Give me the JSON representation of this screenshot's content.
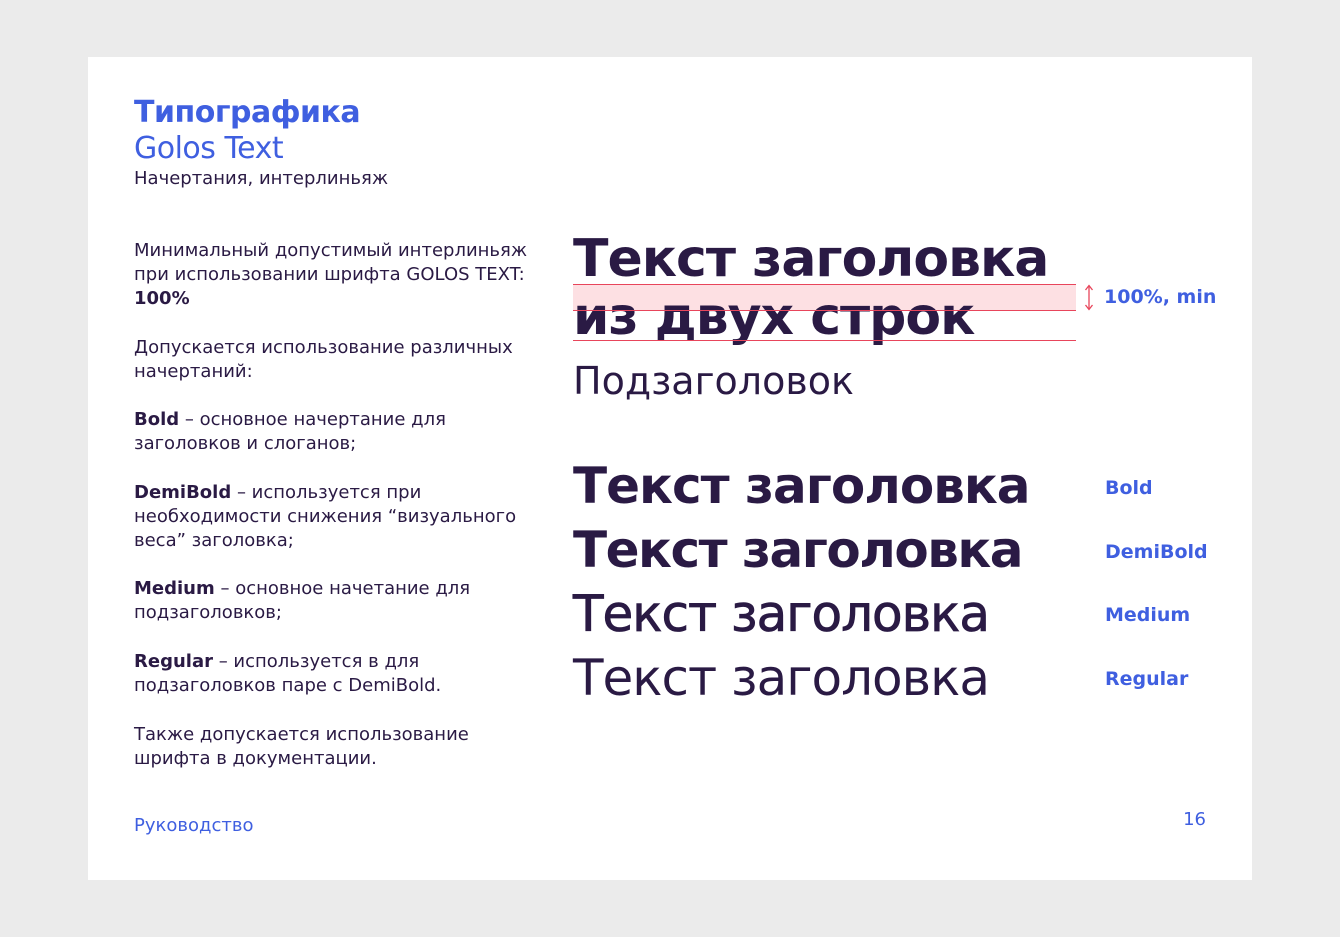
{
  "header": {
    "title": "Типографика",
    "subtitle": "Golos Text",
    "caption": "Начертания, интерлиньяж"
  },
  "body": {
    "p1_text": "Минимальный допустимый интерлиньяж при использовании шрифта GOLOS TEXT: ",
    "p1_bold": "100%",
    "p2": "Допускается использование различных начертаний:",
    "bold_term": "Bold",
    "bold_desc": " – основное начертание для заголовков и слоганов;",
    "demibold_term": "DemiBold",
    "demibold_desc": " – используется при необходимости снижения “визуального веса” заголовка;",
    "medium_term": "Medium",
    "medium_desc": " – основное начетание для подзаголовков;",
    "regular_term": "Regular",
    "regular_desc": " – используется в для подзаголовков паре с DemiBold.",
    "p7": "Также допускается использование шрифта в документации."
  },
  "demo": {
    "heading_line1": "Текст заголовка",
    "heading_line2": "из двух строк",
    "leading_label": "100%, min",
    "subheading": "Подзаголовок"
  },
  "weights": [
    {
      "sample": "Текст заголовка",
      "label": "Bold"
    },
    {
      "sample": "Текст заголовка",
      "label": "DemiBold"
    },
    {
      "sample": "Текст заголовка",
      "label": "Medium"
    },
    {
      "sample": "Текст заголовка",
      "label": "Regular"
    }
  ],
  "footer": {
    "label": "Руководство",
    "page": "16"
  },
  "colors": {
    "accent": "#3f5fe0",
    "text": "#2a1a44",
    "guide": "#e8455b",
    "band": "#fde0e3",
    "background": "#ebebeb"
  }
}
